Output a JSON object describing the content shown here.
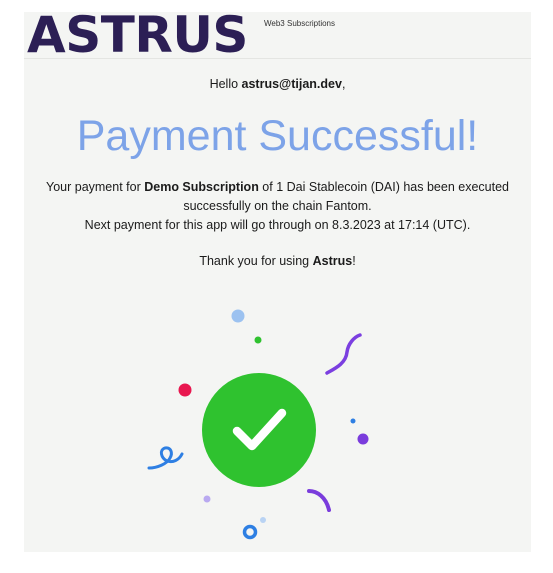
{
  "brand": {
    "name": "ASTRUS",
    "tagline": "Web3 Subscriptions",
    "color": "#2c1f55"
  },
  "greeting": {
    "prefix": "Hello ",
    "email": "astrus@tijan.dev",
    "suffix": ","
  },
  "headline": {
    "text": "Payment Successful!",
    "color": "#7da3e8"
  },
  "message": {
    "line1_prefix": "Your payment for ",
    "subscription": "Demo Subscription",
    "line1_suffix": " of 1 Dai Stablecoin (DAI) has been executed",
    "line2": "successfully on the chain Fantom.",
    "line3": "Next payment for this app will go through on 8.3.2023 at 17:14 (UTC)."
  },
  "thanks": {
    "prefix": "Thank you for using ",
    "brand": "Astrus",
    "suffix": "!"
  },
  "illustration": {
    "success_circle_color": "#2fc22f",
    "icon": "checkmark-icon",
    "confetti_colors": [
      "#9cc2f0",
      "#2fc22f",
      "#7b3fe0",
      "#e8174f",
      "#2e7fe3",
      "#7a3cdc",
      "#b9a9f0"
    ]
  }
}
